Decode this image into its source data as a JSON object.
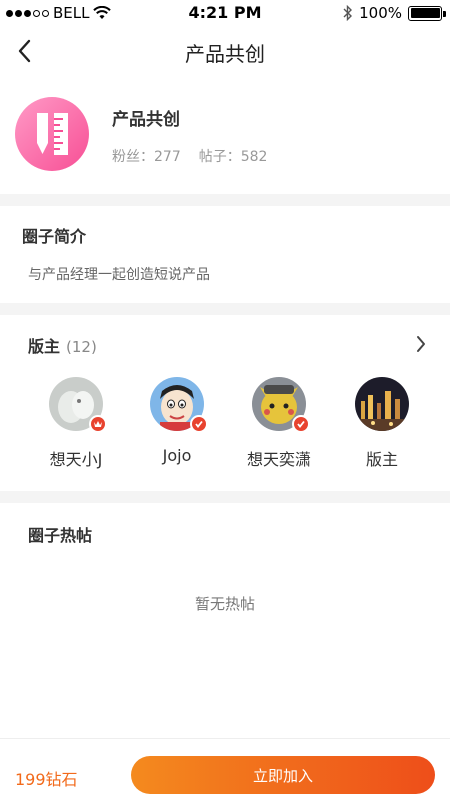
{
  "status_bar": {
    "carrier": "BELL",
    "time": "4:21 PM",
    "battery_label": "100%"
  },
  "nav": {
    "title": "产品共创",
    "back_icon": "chevron-left-icon"
  },
  "circle": {
    "name": "产品共创",
    "fans_label": "粉丝：",
    "fans": "277",
    "posts_label": "帖子：",
    "posts": "582",
    "logo_icon": "ruler-pencil-icon"
  },
  "intro": {
    "title": "圈子简介",
    "text": "与产品经理一起创造短说产品"
  },
  "moderators": {
    "title": "版主",
    "count": "(12)",
    "items": [
      {
        "name": "想天小J"
      },
      {
        "name": "Jojo"
      },
      {
        "name": "想天奕潇"
      },
      {
        "name": "版主"
      }
    ]
  },
  "hot_posts": {
    "title": "圈子热帖",
    "empty_text": "暂无热帖"
  },
  "bottom": {
    "price": "199钻石",
    "join_label": "立即加入"
  },
  "colors": {
    "accent": "#f26a1b",
    "badge": "#e8432f",
    "logo_pink": "#f74f95"
  }
}
